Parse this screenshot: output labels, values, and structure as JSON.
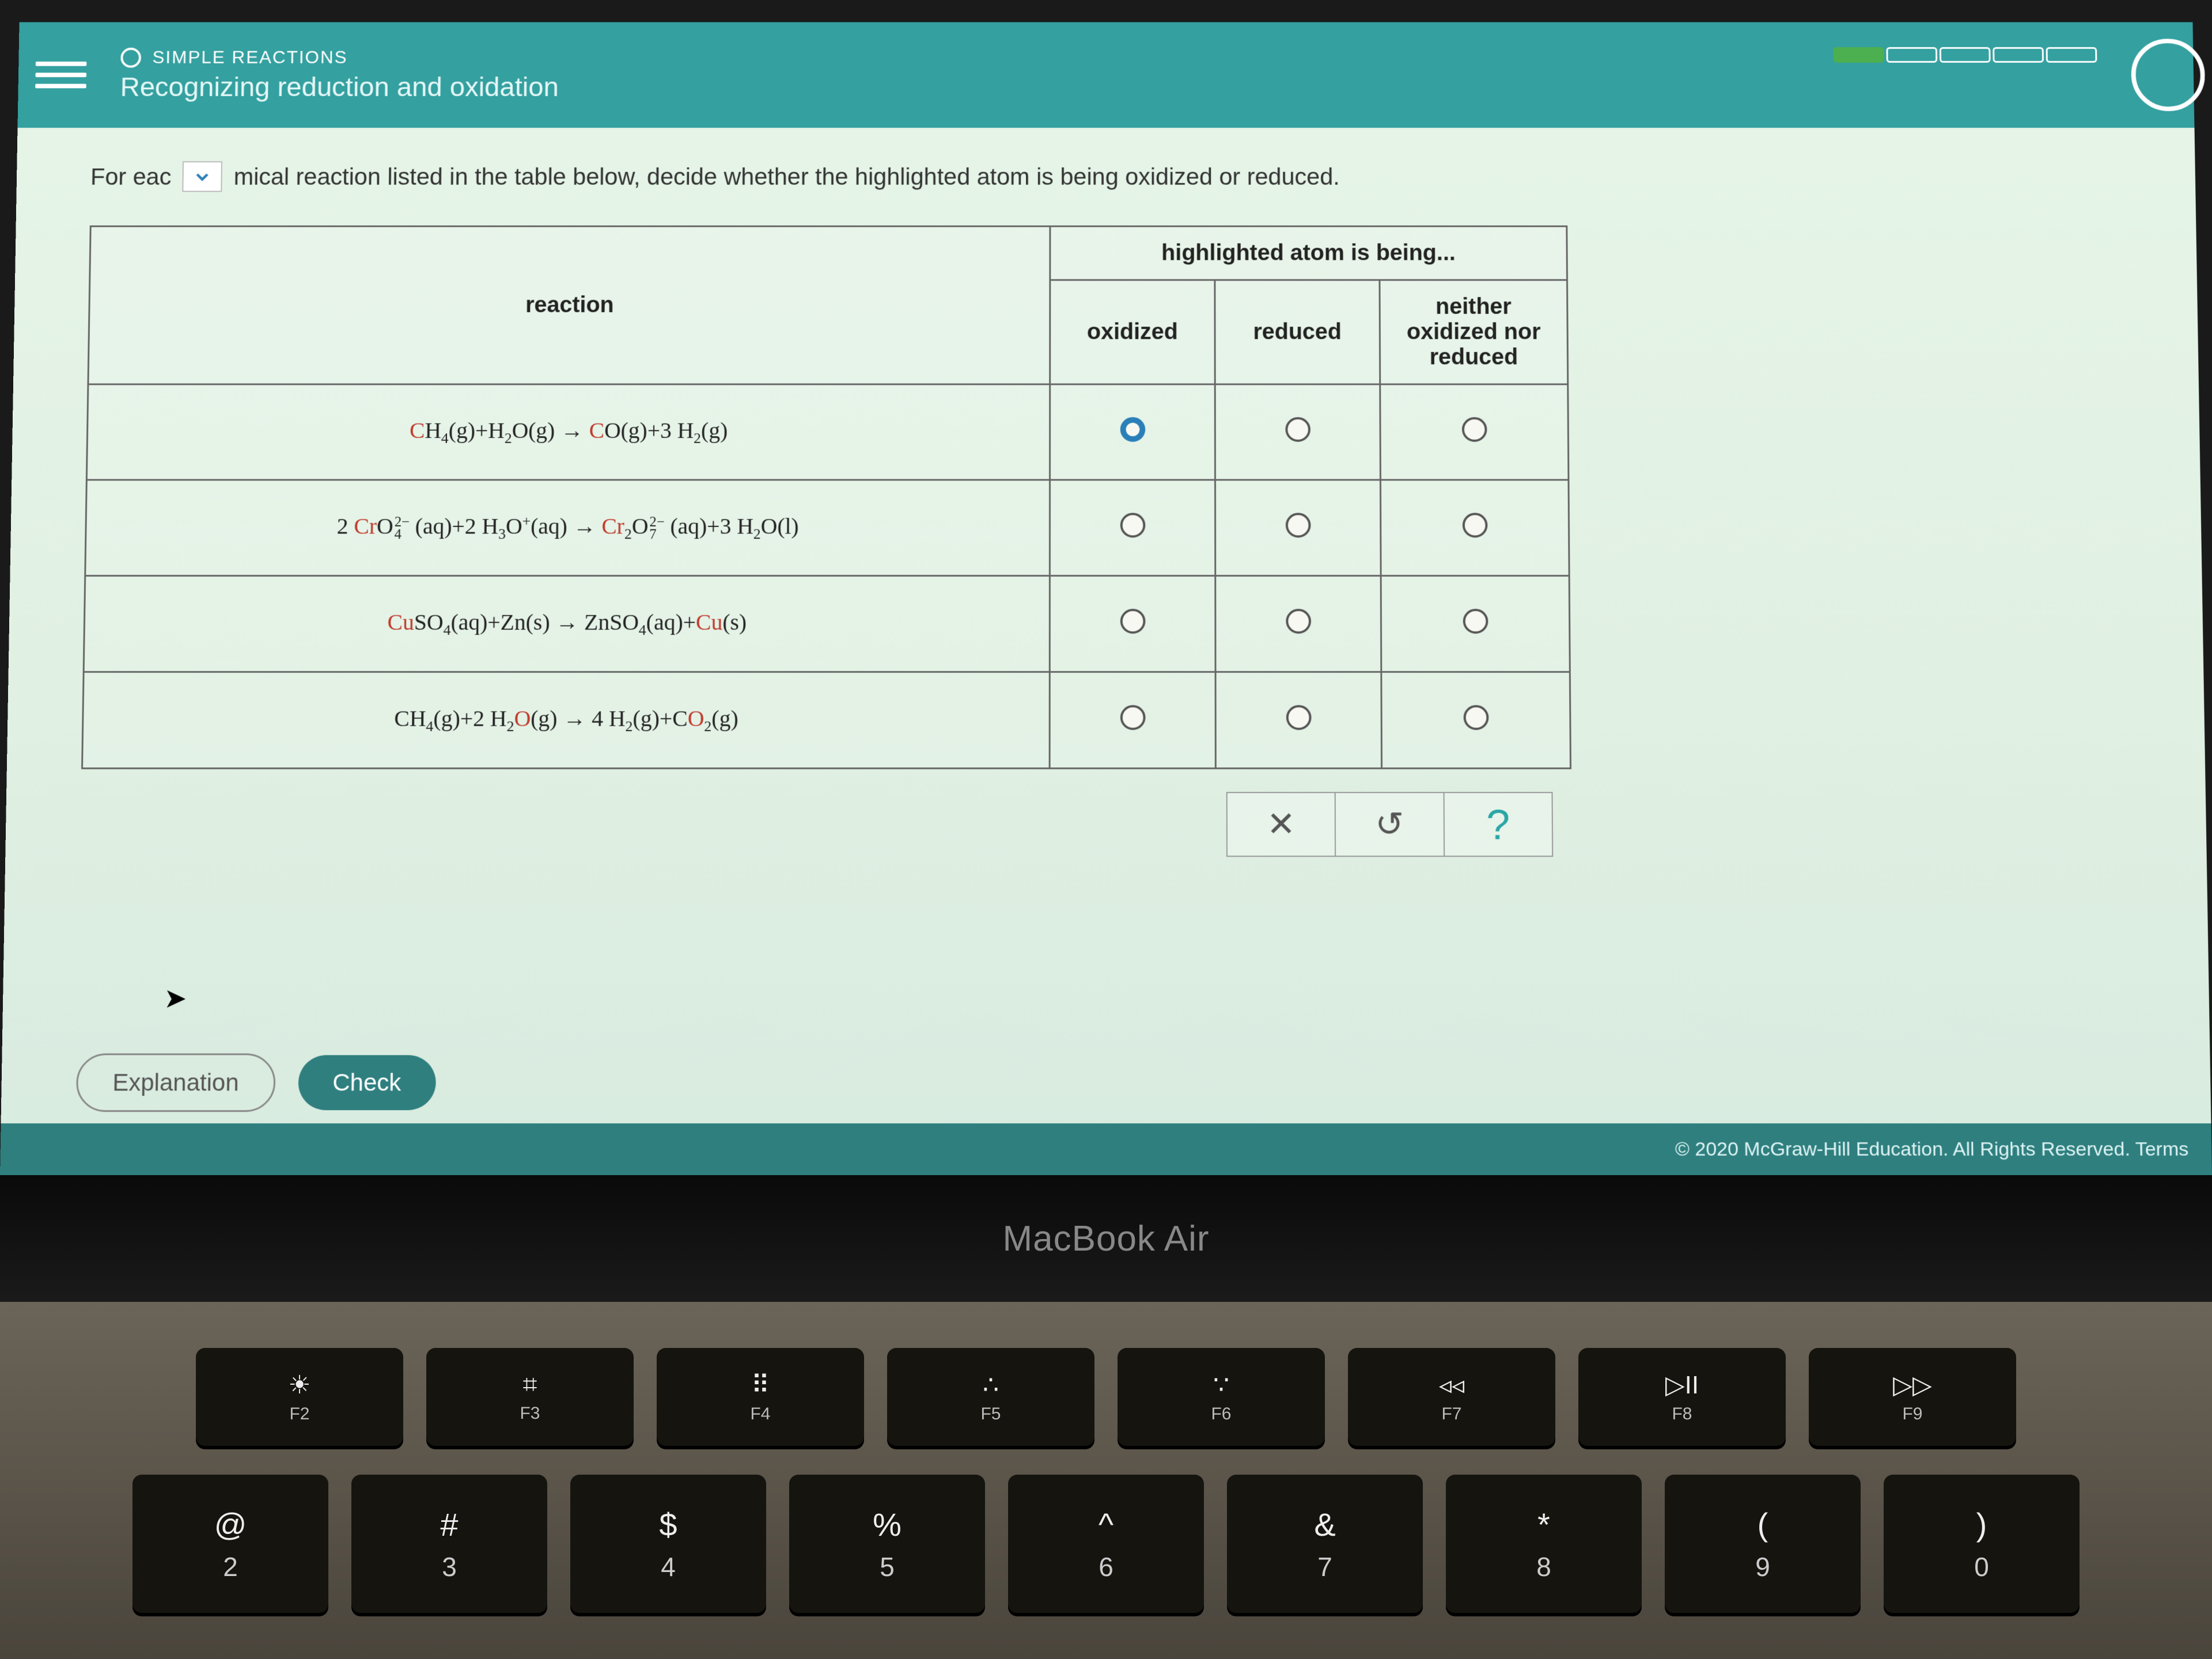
{
  "header": {
    "category": "SIMPLE REACTIONS",
    "subtitle": "Recognizing reduction and oxidation",
    "progress_segments": 5,
    "progress_filled": 1
  },
  "prompt": {
    "before": "For eac",
    "after": "mical reaction listed in the table below, decide whether the highlighted atom is being oxidized or reduced."
  },
  "table": {
    "col_reaction": "reaction",
    "col_group": "highlighted atom is being...",
    "opt1": "oxidized",
    "opt2": "reduced",
    "opt3": "neither oxidized nor reduced",
    "rows": [
      {
        "reaction_html": "<span class='hl'>C</span>H<sub>4</sub>(g)+H<sub>2</sub>O(g) → <span class='hl'>C</span>O(g)+3 H<sub>2</sub>(g)",
        "selected": 0
      },
      {
        "reaction_html": "2 <span class='hl'>Cr</span>O<span class='supsub'><span>2−</span><span>4</span></span> (aq)+2 H<sub>3</sub>O<sup>+</sup>(aq) → <span class='hl'>Cr</span><sub>2</sub>O<span class='supsub'><span>2−</span><span>7</span></span> (aq)+3 H<sub>2</sub>O(l)",
        "selected": -1
      },
      {
        "reaction_html": "<span class='hl'>Cu</span>SO<sub>4</sub>(aq)+Zn(s) → ZnSO<sub>4</sub>(aq)+<span class='hl'>Cu</span>(s)",
        "selected": -1
      },
      {
        "reaction_html": "CH<sub>4</sub>(g)+2 H<sub>2</sub><span class='hl'>O</span>(g) → 4 H<sub>2</sub>(g)+C<span class='hl'>O</span><sub>2</sub>(g)",
        "selected": -1
      }
    ]
  },
  "tools": {
    "clear": "✕",
    "reset": "↺",
    "help": "?"
  },
  "buttons": {
    "explanation": "Explanation",
    "check": "Check"
  },
  "footer": "© 2020 McGraw-Hill Education. All Rights Reserved.   Terms",
  "laptop": {
    "brand": "MacBook Air",
    "fn_keys": [
      {
        "glyph": "☀",
        "label": "F2"
      },
      {
        "glyph": "⌗",
        "label": "F3"
      },
      {
        "glyph": "⠿",
        "label": "F4"
      },
      {
        "glyph": "∴",
        "label": "F5"
      },
      {
        "glyph": "∵",
        "label": "F6"
      },
      {
        "glyph": "◃◃",
        "label": "F7"
      },
      {
        "glyph": "▷II",
        "label": "F8"
      },
      {
        "glyph": "▷▷",
        "label": "F9"
      }
    ],
    "num_keys": [
      {
        "sym": "@",
        "dig": "2"
      },
      {
        "sym": "#",
        "dig": "3"
      },
      {
        "sym": "$",
        "dig": "4"
      },
      {
        "sym": "%",
        "dig": "5"
      },
      {
        "sym": "^",
        "dig": "6"
      },
      {
        "sym": "&",
        "dig": "7"
      },
      {
        "sym": "*",
        "dig": "8"
      },
      {
        "sym": "(",
        "dig": "9"
      },
      {
        "sym": ")",
        "dig": "0"
      }
    ]
  }
}
